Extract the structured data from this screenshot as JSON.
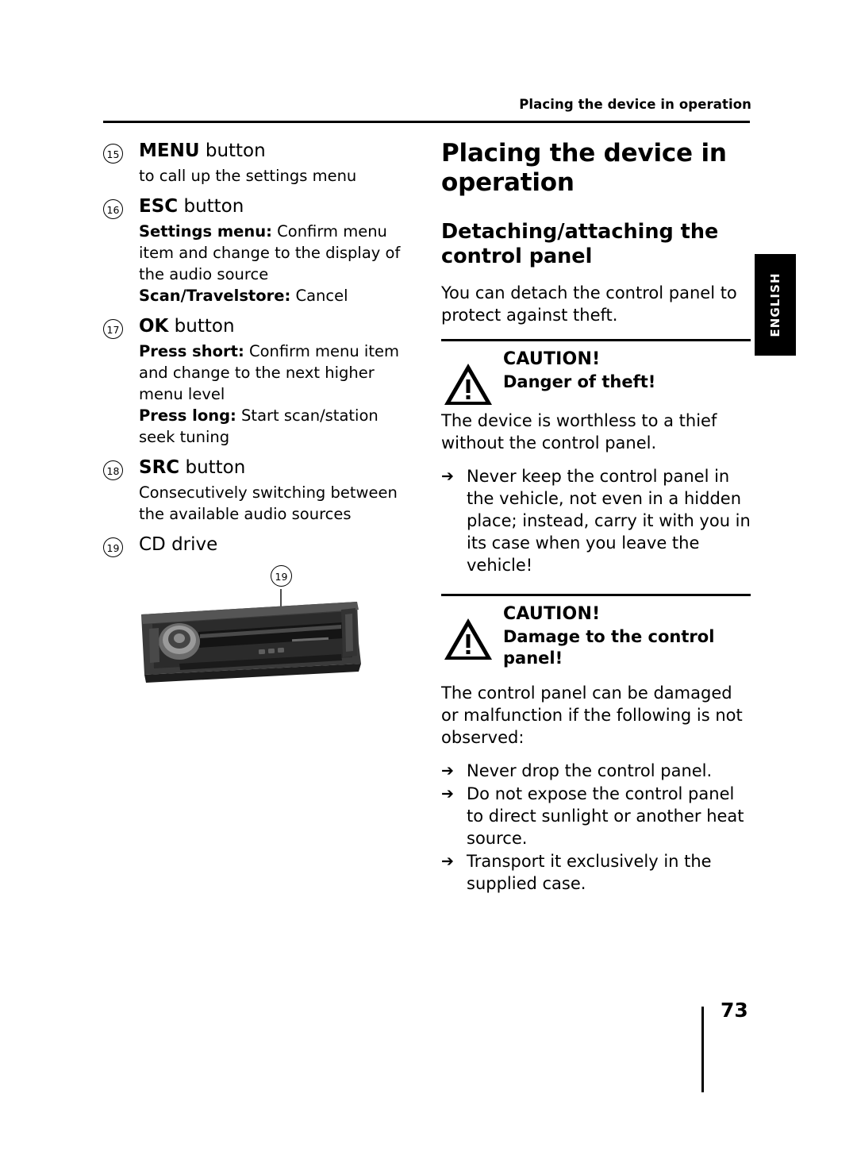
{
  "header": {
    "running_head": "Placing the device in operation"
  },
  "left_column": {
    "items": [
      {
        "number": "15",
        "title_bold": "MENU",
        "title_rest": " button",
        "body": [
          {
            "bold": "",
            "text": "to call up the settings menu"
          }
        ]
      },
      {
        "number": "16",
        "title_bold": "ESC",
        "title_rest": " button",
        "body": [
          {
            "bold": "Settings menu:",
            "text": " Confirm menu item and change to the display of the audio source"
          },
          {
            "bold": "Scan/Travelstore:",
            "text": " Cancel"
          }
        ]
      },
      {
        "number": "17",
        "title_bold": "OK",
        "title_rest": " button",
        "body": [
          {
            "bold": "Press short:",
            "text": " Confirm menu item and change to the next higher menu level"
          },
          {
            "bold": "Press long:",
            "text": " Start scan/station seek tuning"
          }
        ]
      },
      {
        "number": "18",
        "title_bold": "SRC",
        "title_rest": " button",
        "body": [
          {
            "bold": "",
            "text": "Consecutively switching between the available audio sources"
          }
        ]
      },
      {
        "number": "19",
        "title_bold": "",
        "title_rest": "CD drive",
        "body": []
      }
    ],
    "figure_callout": "19"
  },
  "right_column": {
    "section_title": "Placing the device in operation",
    "sub_title": "Detaching/attaching the control panel",
    "intro": "You can detach the control panel to protect against theft.",
    "caution_1": {
      "title": "CAUTION!",
      "subtitle": "Danger of theft!",
      "body": "The device is worthless to a thief without the control panel.",
      "bullets": [
        "Never keep the control panel in the vehicle, not even in a hidden place; instead, carry it with you in its case when you leave the vehicle!"
      ]
    },
    "caution_2": {
      "title": "CAUTION!",
      "subtitle": "Damage to the control panel!",
      "body": "The control panel can be damaged or malfunction if the following is not observed:",
      "bullets": [
        "Never drop the control panel.",
        "Do not expose the control panel to direct sunlight or another heat source.",
        "Transport it exclusively in the supplied case."
      ]
    }
  },
  "side_tab": {
    "label": "ENGLISH"
  },
  "footer": {
    "page_number": "73"
  }
}
